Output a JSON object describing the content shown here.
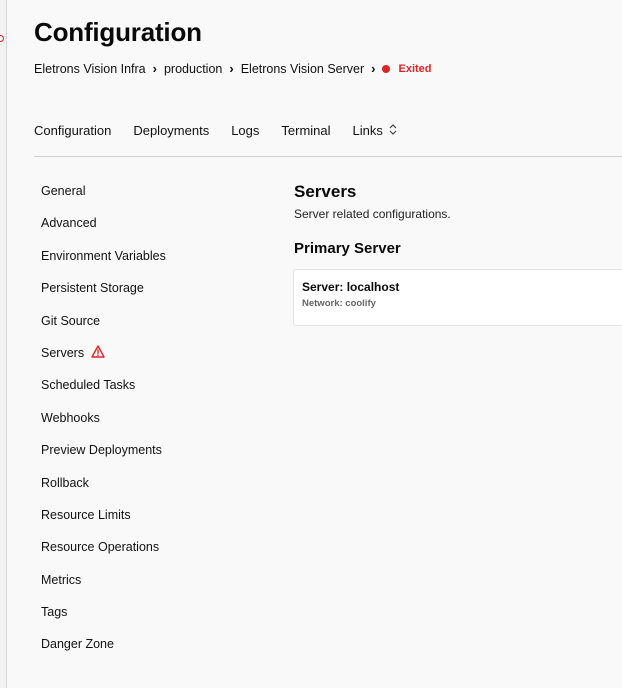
{
  "header": {
    "title": "Configuration",
    "breadcrumb": {
      "items": [
        "Eletrons Vision Infra",
        "production",
        "Eletrons Vision Server"
      ],
      "separator": "›",
      "status": "Exited"
    }
  },
  "tabs": [
    {
      "label": "Configuration"
    },
    {
      "label": "Deployments"
    },
    {
      "label": "Logs"
    },
    {
      "label": "Terminal"
    },
    {
      "label": "Links",
      "icon": "chevron-up-down-icon"
    }
  ],
  "sidebar": {
    "items": [
      {
        "label": "General"
      },
      {
        "label": "Advanced"
      },
      {
        "label": "Environment Variables"
      },
      {
        "label": "Persistent Storage"
      },
      {
        "label": "Git Source"
      },
      {
        "label": "Servers",
        "icon": "warning-icon"
      },
      {
        "label": "Scheduled Tasks"
      },
      {
        "label": "Webhooks"
      },
      {
        "label": "Preview Deployments"
      },
      {
        "label": "Rollback"
      },
      {
        "label": "Resource Limits"
      },
      {
        "label": "Resource Operations"
      },
      {
        "label": "Metrics"
      },
      {
        "label": "Tags"
      },
      {
        "label": "Danger Zone"
      }
    ]
  },
  "main": {
    "title": "Servers",
    "subtitle": "Server related configurations.",
    "section_title": "Primary Server",
    "server_card": {
      "name": "Server: localhost",
      "network": "Network: coolify"
    }
  },
  "colors": {
    "status_red": "#dc2626",
    "background": "#f9f9f9",
    "card_background": "#ffffff"
  }
}
